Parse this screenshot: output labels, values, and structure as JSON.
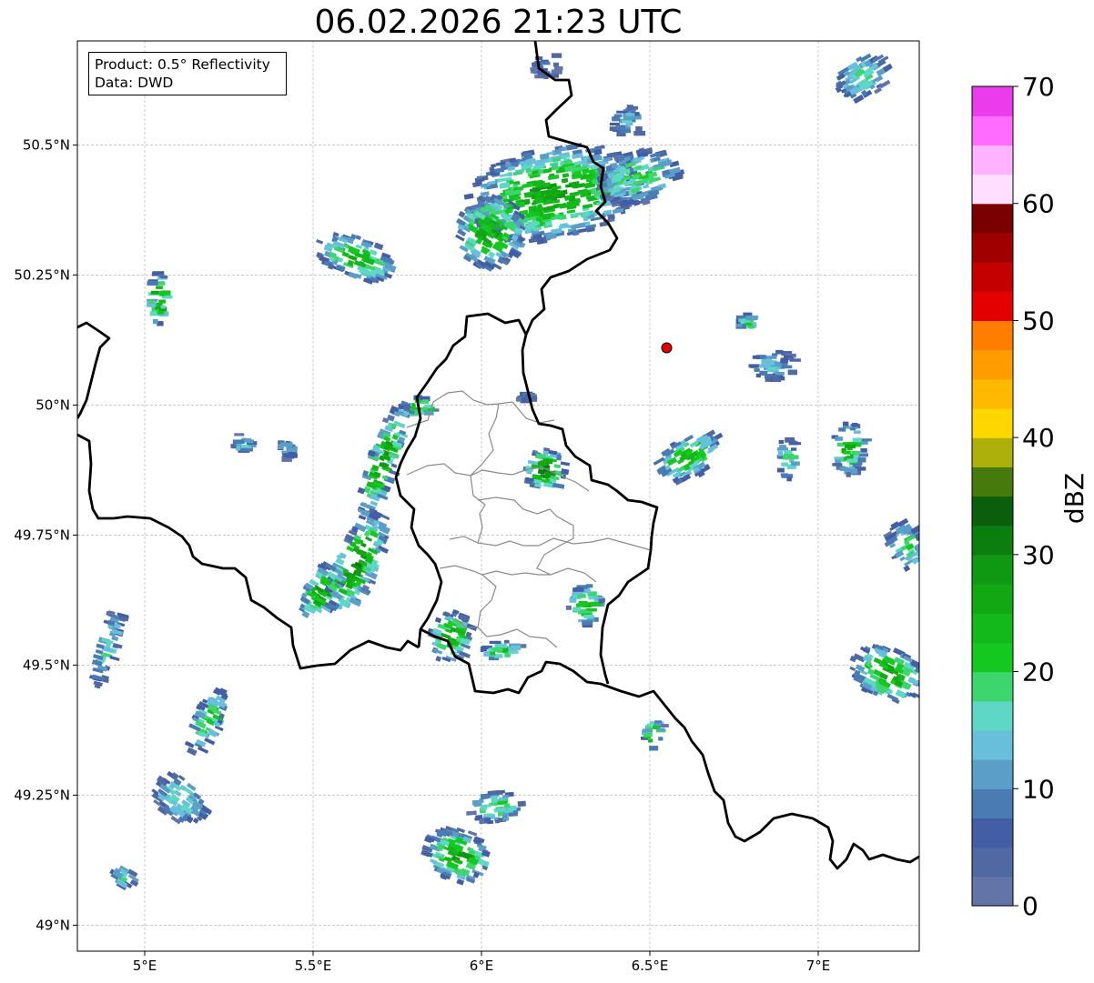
{
  "title": "06.02.2026 21:23 UTC",
  "info_box": {
    "product": "Product: 0.5° Reflectivity",
    "data_source": "Data: DWD"
  },
  "map": {
    "lon_range": [
      4.8,
      7.3
    ],
    "lat_range": [
      48.95,
      50.7
    ],
    "lon_ticks": [
      "5°E",
      "5.5°E",
      "6°E",
      "6.5°E",
      "7°E"
    ],
    "lat_ticks": [
      "49°N",
      "49.25°N",
      "49.5°N",
      "49.75°N",
      "50°N",
      "50.25°N",
      "50.5°N"
    ],
    "grid": true,
    "radar_site": {
      "lon": 6.55,
      "lat": 50.11,
      "color": "#e60000"
    }
  },
  "colorbar": {
    "label": "dBZ",
    "ticks": [
      "0",
      "10",
      "20",
      "30",
      "40",
      "50",
      "60",
      "70"
    ],
    "range": [
      0,
      70
    ],
    "colors": [
      "#6274a8",
      "#5069a2",
      "#435ea4",
      "#4a7bb3",
      "#5b9ec8",
      "#67bfdb",
      "#5ed7c6",
      "#3dd56d",
      "#15c820",
      "#13b81a",
      "#11a814",
      "#0f9812",
      "#0c7e0f",
      "#0a5e0c",
      "#477a0c",
      "#adb00a",
      "#ffd700",
      "#ffba00",
      "#ff9d00",
      "#ff7e00",
      "#e40000",
      "#c40000",
      "#a00000",
      "#7a0000",
      "#ffdeff",
      "#ffb2ff",
      "#ff6cff",
      "#ea3cea"
    ]
  },
  "echoes": [
    {
      "lon": 6.2,
      "lat": 50.41,
      "rx": 0.26,
      "ry": 0.09,
      "rot": -10,
      "dbz": 27
    },
    {
      "lon": 6.02,
      "lat": 50.34,
      "rx": 0.1,
      "ry": 0.07,
      "rot": 30,
      "dbz": 26
    },
    {
      "lon": 6.45,
      "lat": 50.44,
      "rx": 0.13,
      "ry": 0.05,
      "rot": -15,
      "dbz": 20
    },
    {
      "lon": 6.42,
      "lat": 50.55,
      "rx": 0.05,
      "ry": 0.03,
      "rot": 0,
      "dbz": 14
    },
    {
      "lon": 5.62,
      "lat": 50.29,
      "rx": 0.12,
      "ry": 0.04,
      "rot": 20,
      "dbz": 24
    },
    {
      "lon": 5.03,
      "lat": 50.21,
      "rx": 0.03,
      "ry": 0.05,
      "rot": 0,
      "dbz": 28
    },
    {
      "lon": 6.18,
      "lat": 50.66,
      "rx": 0.04,
      "ry": 0.03,
      "rot": 0,
      "dbz": 10
    },
    {
      "lon": 7.12,
      "lat": 50.63,
      "rx": 0.08,
      "ry": 0.04,
      "rot": -30,
      "dbz": 18
    },
    {
      "lon": 5.8,
      "lat": 50.0,
      "rx": 0.05,
      "ry": 0.02,
      "rot": 0,
      "dbz": 26
    },
    {
      "lon": 5.7,
      "lat": 49.9,
      "rx": 0.04,
      "ry": 0.12,
      "rot": 20,
      "dbz": 27
    },
    {
      "lon": 5.62,
      "lat": 49.7,
      "rx": 0.06,
      "ry": 0.11,
      "rot": 25,
      "dbz": 29
    },
    {
      "lon": 5.52,
      "lat": 49.65,
      "rx": 0.05,
      "ry": 0.06,
      "rot": 30,
      "dbz": 27
    },
    {
      "lon": 6.18,
      "lat": 49.88,
      "rx": 0.06,
      "ry": 0.04,
      "rot": 10,
      "dbz": 30
    },
    {
      "lon": 6.3,
      "lat": 49.62,
      "rx": 0.05,
      "ry": 0.04,
      "rot": 0,
      "dbz": 25
    },
    {
      "lon": 5.9,
      "lat": 49.56,
      "rx": 0.06,
      "ry": 0.05,
      "rot": 20,
      "dbz": 26
    },
    {
      "lon": 6.05,
      "lat": 49.53,
      "rx": 0.06,
      "ry": 0.02,
      "rot": 0,
      "dbz": 22
    },
    {
      "lon": 6.6,
      "lat": 49.9,
      "rx": 0.1,
      "ry": 0.04,
      "rot": -30,
      "dbz": 24
    },
    {
      "lon": 6.9,
      "lat": 49.9,
      "rx": 0.03,
      "ry": 0.04,
      "rot": 0,
      "dbz": 20
    },
    {
      "lon": 7.08,
      "lat": 49.92,
      "rx": 0.05,
      "ry": 0.05,
      "rot": 0,
      "dbz": 25
    },
    {
      "lon": 6.85,
      "lat": 50.08,
      "rx": 0.07,
      "ry": 0.03,
      "rot": 0,
      "dbz": 14
    },
    {
      "lon": 6.78,
      "lat": 50.16,
      "rx": 0.03,
      "ry": 0.02,
      "rot": 0,
      "dbz": 20
    },
    {
      "lon": 7.2,
      "lat": 49.49,
      "rx": 0.11,
      "ry": 0.05,
      "rot": 25,
      "dbz": 26
    },
    {
      "lon": 7.25,
      "lat": 49.73,
      "rx": 0.05,
      "ry": 0.05,
      "rot": -30,
      "dbz": 20
    },
    {
      "lon": 6.5,
      "lat": 49.37,
      "rx": 0.03,
      "ry": 0.03,
      "rot": 0,
      "dbz": 28
    },
    {
      "lon": 5.92,
      "lat": 49.14,
      "rx": 0.1,
      "ry": 0.05,
      "rot": 20,
      "dbz": 26
    },
    {
      "lon": 6.03,
      "lat": 49.23,
      "rx": 0.08,
      "ry": 0.03,
      "rot": -5,
      "dbz": 20
    },
    {
      "lon": 5.18,
      "lat": 49.4,
      "rx": 0.04,
      "ry": 0.07,
      "rot": 25,
      "dbz": 22
    },
    {
      "lon": 5.1,
      "lat": 49.25,
      "rx": 0.09,
      "ry": 0.04,
      "rot": 35,
      "dbz": 18
    },
    {
      "lon": 4.88,
      "lat": 49.54,
      "rx": 0.03,
      "ry": 0.08,
      "rot": 15,
      "dbz": 16
    },
    {
      "lon": 4.93,
      "lat": 49.1,
      "rx": 0.04,
      "ry": 0.02,
      "rot": 30,
      "dbz": 16
    },
    {
      "lon": 5.28,
      "lat": 49.93,
      "rx": 0.03,
      "ry": 0.02,
      "rot": 0,
      "dbz": 16
    },
    {
      "lon": 5.41,
      "lat": 49.92,
      "rx": 0.02,
      "ry": 0.02,
      "rot": 0,
      "dbz": 14
    },
    {
      "lon": 6.12,
      "lat": 50.02,
      "rx": 0.02,
      "ry": 0.01,
      "rot": 0,
      "dbz": 10
    }
  ]
}
